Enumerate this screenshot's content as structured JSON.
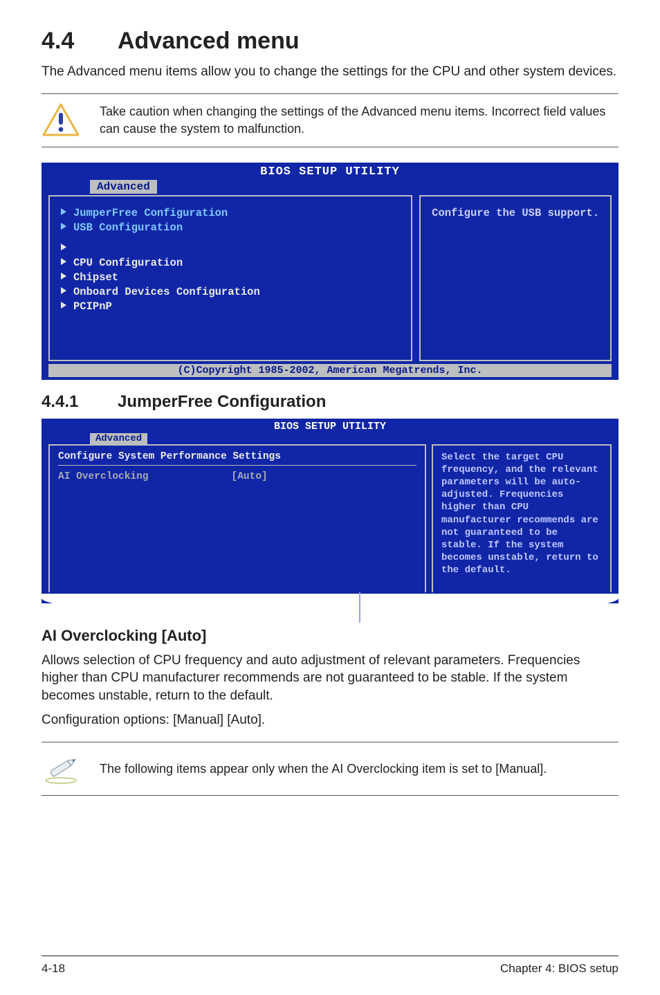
{
  "section": {
    "number": "4.4",
    "title": "Advanced menu"
  },
  "intro": "The Advanced menu items allow you to change the settings for the CPU and other system devices.",
  "caution": "Take caution when changing the settings of the Advanced menu items. Incorrect field values can cause the system to malfunction.",
  "bios1": {
    "title": "BIOS SETUP UTILITY",
    "tab": "Advanced",
    "left_highlight": [
      "JumperFree Configuration",
      "USB Configuration"
    ],
    "left_items": [
      "CPU Configuration",
      "Chipset",
      "Onboard Devices Configuration",
      "PCIPnP"
    ],
    "help": "Configure the USB support.",
    "copyright": "(C)Copyright 1985-2002, American Megatrends, Inc."
  },
  "subsection": {
    "number": "4.4.1",
    "title": "JumperFree Configuration"
  },
  "bios2": {
    "title": "BIOS SETUP UTILITY",
    "tab": "Advanced",
    "panel_heading": "Configure System Performance Settings",
    "row": {
      "label": "AI Overclocking",
      "value": "[Auto]"
    },
    "help": "Select the target CPU frequency, and the relevant parameters will be auto-adjusted. Frequencies higher than CPU manufacturer recommends are not guaranteed to be stable. If the system becomes unstable, return to the default."
  },
  "field": {
    "title": "AI Overclocking [Auto]"
  },
  "field_body1": "Allows selection of CPU frequency and auto adjustment of relevant parameters. Frequencies higher than CPU manufacturer recommends are not guaranteed to be stable. If the system becomes unstable, return to the default.",
  "field_body2": "Configuration options: [Manual] [Auto].",
  "tip": "The following items appear only when the AI Overclocking item is set to [Manual].",
  "footer": {
    "left": "4-18",
    "right": "Chapter 4: BIOS setup"
  }
}
